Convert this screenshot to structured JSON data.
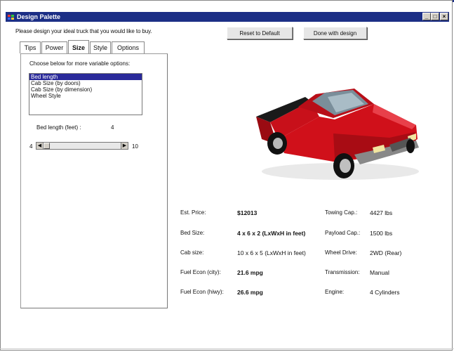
{
  "window": {
    "title": "Design Palette"
  },
  "intro_text": "Please design your ideal truck that you would like to buy.",
  "buttons": {
    "reset": "Reset to Default",
    "done": "Done with design"
  },
  "tabs": [
    "Tips",
    "Power",
    "Size",
    "Style",
    "Options"
  ],
  "active_tab": "Size",
  "size_panel": {
    "instruction": "Choose below for more variable options:",
    "options": [
      "Bed length",
      "Cab Size (by doors)",
      "Cab Size (by dimension)",
      "Wheel Style"
    ],
    "selected_option": "Bed length",
    "bed_label": "Bed length (feet) :",
    "bed_value": "4",
    "slider_min": "4",
    "slider_max": "10",
    "slider_level": 0
  },
  "specs": {
    "price_label": "Est. Price:",
    "price_value": "$12013",
    "bed_label": "Bed Size:",
    "bed_value": "4 x 6 x 2 (LxWxH in feet)",
    "cab_label": "Cab size:",
    "cab_value": "10 x 6 x 5 (LxWxH in feet)",
    "city_label": "Fuel Econ (city):",
    "city_value": "21.6 mpg",
    "hwy_label": "Fuel Econ (hiwy):",
    "hwy_value": "26.6 mpg",
    "towing_label": "Towing Cap.:",
    "towing_value": "4427 lbs",
    "payload_label": "Payload Cap.:",
    "payload_value": "1500 lbs",
    "drive_label": "Wheel Drive:",
    "drive_value": "2WD (Rear)",
    "trans_label": "Transmission:",
    "trans_value": "Manual",
    "engine_label": "Engine:",
    "engine_value": "4 Cylinders"
  },
  "colors": {
    "titlebar": "#1c2f86",
    "truck_body": "#d0101a",
    "selection": "#2a2a9a"
  }
}
